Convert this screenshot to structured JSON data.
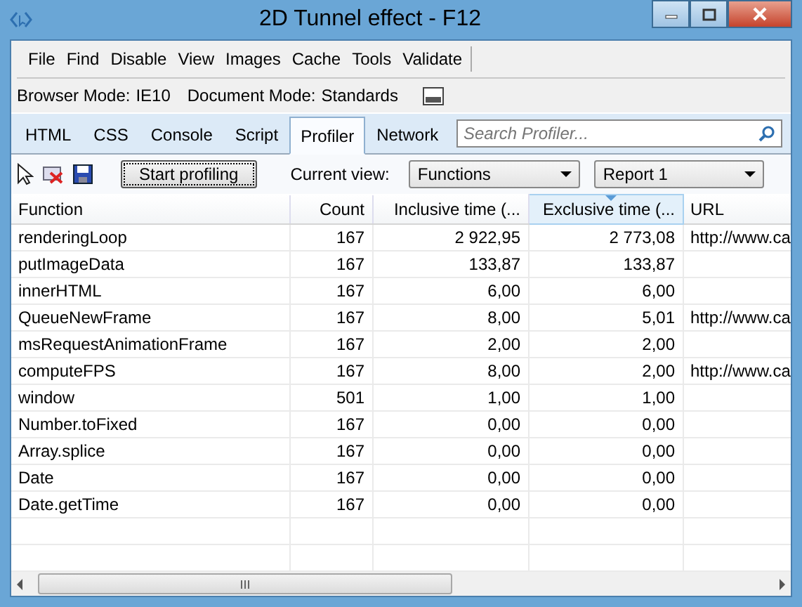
{
  "window": {
    "title": "2D Tunnel effect - F12"
  },
  "menu": [
    "File",
    "Find",
    "Disable",
    "View",
    "Images",
    "Cache",
    "Tools",
    "Validate"
  ],
  "mode_bar": {
    "browser_mode_label": "Browser Mode:",
    "browser_mode": "IE10",
    "document_mode_label": "Document Mode:",
    "document_mode": "Standards"
  },
  "tabs": [
    {
      "label": "HTML",
      "selected": false
    },
    {
      "label": "CSS",
      "selected": false
    },
    {
      "label": "Console",
      "selected": false
    },
    {
      "label": "Script",
      "selected": false
    },
    {
      "label": "Profiler",
      "selected": true
    },
    {
      "label": "Network",
      "selected": false
    }
  ],
  "search": {
    "placeholder": "Search Profiler..."
  },
  "toolbar": {
    "start_button": "Start profiling",
    "current_view_label": "Current view:",
    "view": "Functions",
    "report": "Report 1"
  },
  "table": {
    "columns": [
      {
        "label": "Function",
        "sorted": false
      },
      {
        "label": "Count",
        "sorted": false
      },
      {
        "label": "Inclusive time (...",
        "sorted": false
      },
      {
        "label": "Exclusive time (...",
        "sorted": true
      },
      {
        "label": "URL",
        "sorted": false
      }
    ],
    "rows": [
      [
        "renderingLoop",
        "167",
        "2 922,95",
        "2 773,08",
        "http://www.ca"
      ],
      [
        "putImageData",
        "167",
        "133,87",
        "133,87",
        ""
      ],
      [
        "innerHTML",
        "167",
        "6,00",
        "6,00",
        ""
      ],
      [
        "QueueNewFrame",
        "167",
        "8,00",
        "5,01",
        "http://www.ca"
      ],
      [
        "msRequestAnimationFrame",
        "167",
        "2,00",
        "2,00",
        ""
      ],
      [
        "computeFPS",
        "167",
        "8,00",
        "2,00",
        "http://www.ca"
      ],
      [
        "window",
        "501",
        "1,00",
        "1,00",
        ""
      ],
      [
        "Number.toFixed",
        "167",
        "0,00",
        "0,00",
        ""
      ],
      [
        "Array.splice",
        "167",
        "0,00",
        "0,00",
        ""
      ],
      [
        "Date",
        "167",
        "0,00",
        "0,00",
        ""
      ],
      [
        "Date.getTime",
        "167",
        "0,00",
        "0,00",
        ""
      ]
    ]
  }
}
